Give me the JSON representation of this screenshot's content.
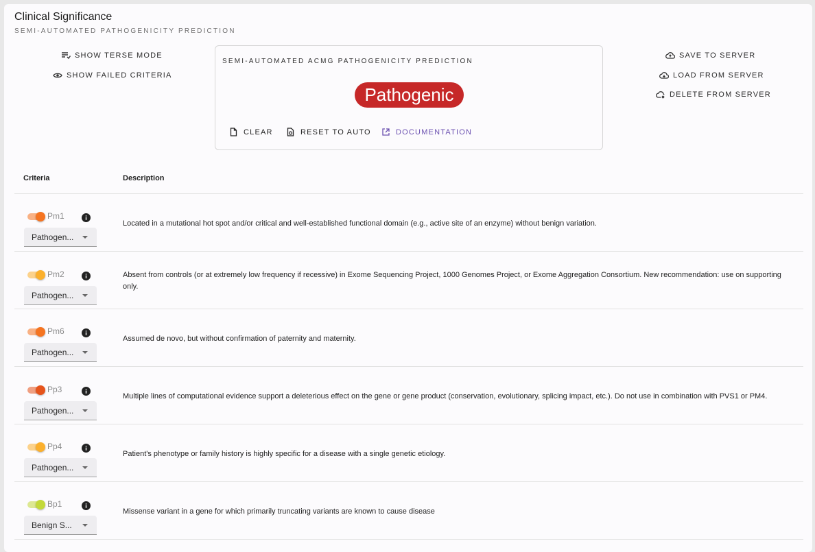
{
  "header": {
    "title": "Clinical Significance",
    "subtitle": "SEMI-AUTOMATED PATHOGENICITY PREDICTION"
  },
  "left_actions": {
    "terse": "SHOW TERSE MODE",
    "failed": "SHOW FAILED CRITERIA"
  },
  "right_actions": {
    "save": "SAVE TO SERVER",
    "load": "LOAD FROM SERVER",
    "delete": "DELETE FROM SERVER"
  },
  "prediction": {
    "title": "SEMI-AUTOMATED ACMG PATHOGENICITY PREDICTION",
    "result": "Pathogenic",
    "result_color": "#c62828",
    "clear": "CLEAR",
    "reset": "RESET TO AUTO",
    "docs": "DOCUMENTATION"
  },
  "table": {
    "col_criteria": "Criteria",
    "col_description": "Description",
    "rows": [
      {
        "code": "Pm1",
        "enabled": true,
        "color": "#f57421",
        "strength": "Pathogen...",
        "description": "Located in a mutational hot spot and/or critical and well-established functional domain (e.g., active site of an enzyme) without benign variation."
      },
      {
        "code": "Pm2",
        "enabled": true,
        "color": "#fbb02d",
        "strength": "Pathogen...",
        "description": "Absent from controls (or at extremely low frequency if recessive) in Exome Sequencing Project, 1000 Genomes Project, or Exome Aggregation Consortium. New recommendation: use on supporting only."
      },
      {
        "code": "Pm6",
        "enabled": true,
        "color": "#f57421",
        "strength": "Pathogen...",
        "description": "Assumed de novo, but without confirmation of paternity and maternity."
      },
      {
        "code": "Pp3",
        "enabled": true,
        "color": "#e6541b",
        "strength": "Pathogen...",
        "description": "Multiple lines of computational evidence support a deleterious effect on the gene or gene product (conservation, evolutionary, splicing impact, etc.). Do not use in combination with PVS1 or PM4."
      },
      {
        "code": "Pp4",
        "enabled": true,
        "color": "#fbb02d",
        "strength": "Pathogen...",
        "description": "Patient's phenotype or family history is highly specific for a disease with a single genetic etiology."
      },
      {
        "code": "Bp1",
        "enabled": true,
        "color": "#c3d93a",
        "strength": "Benign S...",
        "description": "Missense variant in a gene for which primarily truncating variants are known to cause disease"
      }
    ]
  }
}
